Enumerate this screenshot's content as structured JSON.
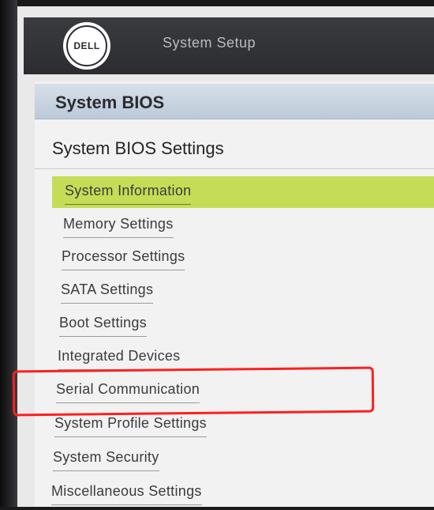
{
  "header": {
    "brand_logo_text": "DELL",
    "title": "System Setup"
  },
  "section": {
    "title": "System BIOS"
  },
  "page": {
    "title": "System BIOS Settings"
  },
  "menu": {
    "items": [
      {
        "label": "System Information",
        "selected": true
      },
      {
        "label": "Memory Settings"
      },
      {
        "label": "Processor Settings"
      },
      {
        "label": "SATA Settings"
      },
      {
        "label": "Boot Settings"
      },
      {
        "label": "Integrated Devices"
      },
      {
        "label": "Serial Communication",
        "annotated": true
      },
      {
        "label": "System Profile Settings"
      },
      {
        "label": "System Security"
      },
      {
        "label": "Miscellaneous Settings"
      }
    ]
  },
  "colors": {
    "selected_background": "#c5dd56",
    "header_background": "#2b2c30",
    "section_bar": "#bcc9d8",
    "annotation_outline": "#ff1f1f"
  }
}
